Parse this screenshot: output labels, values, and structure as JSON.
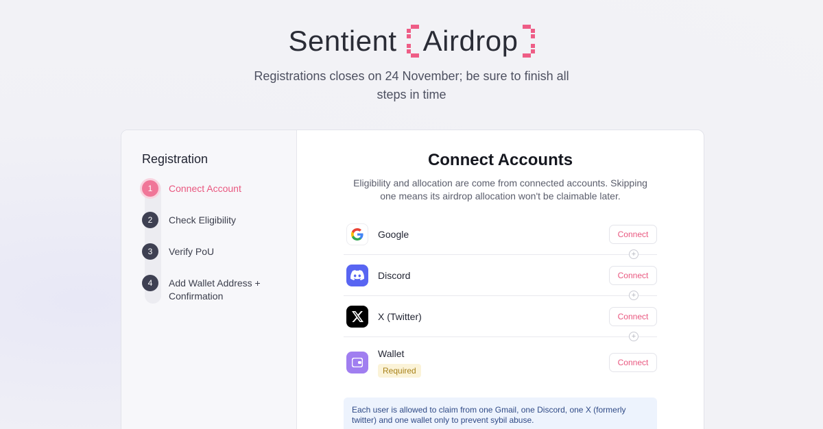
{
  "header": {
    "brand": "Sentient",
    "product": "Airdrop",
    "subtitle": "Registrations closes on 24 November; be sure to finish all steps in time"
  },
  "sidebar": {
    "title": "Registration",
    "steps": [
      {
        "num": "1",
        "label": "Connect Account",
        "active": true
      },
      {
        "num": "2",
        "label": "Check Eligibility"
      },
      {
        "num": "3",
        "label": "Verify PoU"
      },
      {
        "num": "4",
        "label": "Add Wallet Address + Confirmation"
      }
    ]
  },
  "main": {
    "title": "Connect Accounts",
    "description": "Eligibility and allocation are come from connected accounts. Skipping one means its airdrop allocation won't be claimable later.",
    "accounts": [
      {
        "name": "Google",
        "icon": "google-icon",
        "button": "Connect"
      },
      {
        "name": "Discord",
        "icon": "discord-icon",
        "button": "Connect"
      },
      {
        "name": "X (Twitter)",
        "icon": "x-icon",
        "button": "Connect"
      },
      {
        "name": "Wallet",
        "icon": "wallet-icon",
        "button": "Connect",
        "badge": "Required"
      }
    ],
    "notice": "Each user is allowed to claim from one Gmail, one Discord, one X (formerly twitter) and one wallet only to prevent sybil abuse."
  },
  "colors": {
    "accent": "#ee5d86",
    "discord": "#5865f2",
    "wallet": "#a07ef0"
  }
}
